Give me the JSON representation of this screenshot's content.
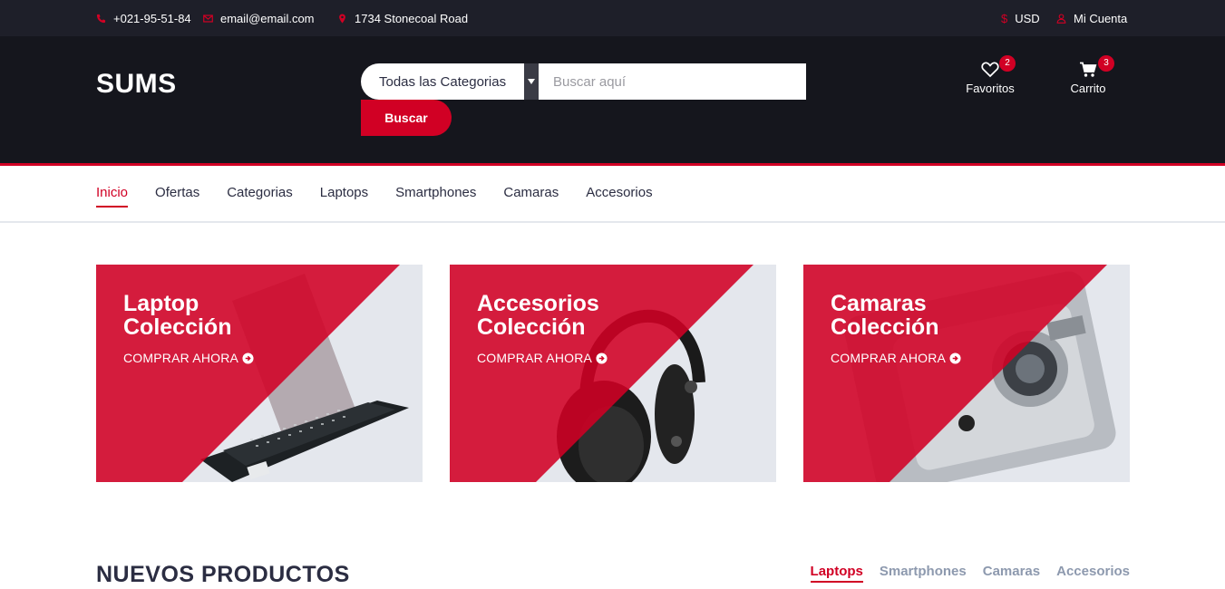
{
  "topbar": {
    "phone": "+021-95-51-84",
    "email": "email@email.com",
    "address": "1734 Stonecoal Road",
    "currency": "USD",
    "account": "Mi Cuenta"
  },
  "header": {
    "logo": "SUMS",
    "category_select": "Todas las Categorias",
    "search_placeholder": "Buscar aquí",
    "search_button": "Buscar",
    "wishlist": {
      "label": "Favoritos",
      "count": "2"
    },
    "cart": {
      "label": "Carrito",
      "count": "3"
    }
  },
  "nav": {
    "items": [
      "Inicio",
      "Ofertas",
      "Categorias",
      "Laptops",
      "Smartphones",
      "Camaras",
      "Accesorios"
    ]
  },
  "collections": [
    {
      "line1": "Laptop",
      "line2": "Colección",
      "cta": "COMPRAR AHORA"
    },
    {
      "line1": "Accesorios",
      "line2": "Colección",
      "cta": "COMPRAR AHORA"
    },
    {
      "line1": "Camaras",
      "line2": "Colección",
      "cta": "COMPRAR AHORA"
    }
  ],
  "new_products": {
    "title": "NUEVOS PRODUCTOS",
    "tabs": [
      "Laptops",
      "Smartphones",
      "Camaras",
      "Accesorios"
    ]
  },
  "colors": {
    "accent": "#d10024",
    "dark": "#15161d",
    "topbar": "#1e1f29",
    "text": "#2b2d42",
    "muted": "#8d99ae"
  },
  "icons": [
    "phone-icon",
    "envelope-icon",
    "map-marker-icon",
    "dollar-icon",
    "user-icon",
    "heart-icon",
    "cart-icon",
    "arrow-circle-right-icon",
    "chevron-down-icon"
  ]
}
